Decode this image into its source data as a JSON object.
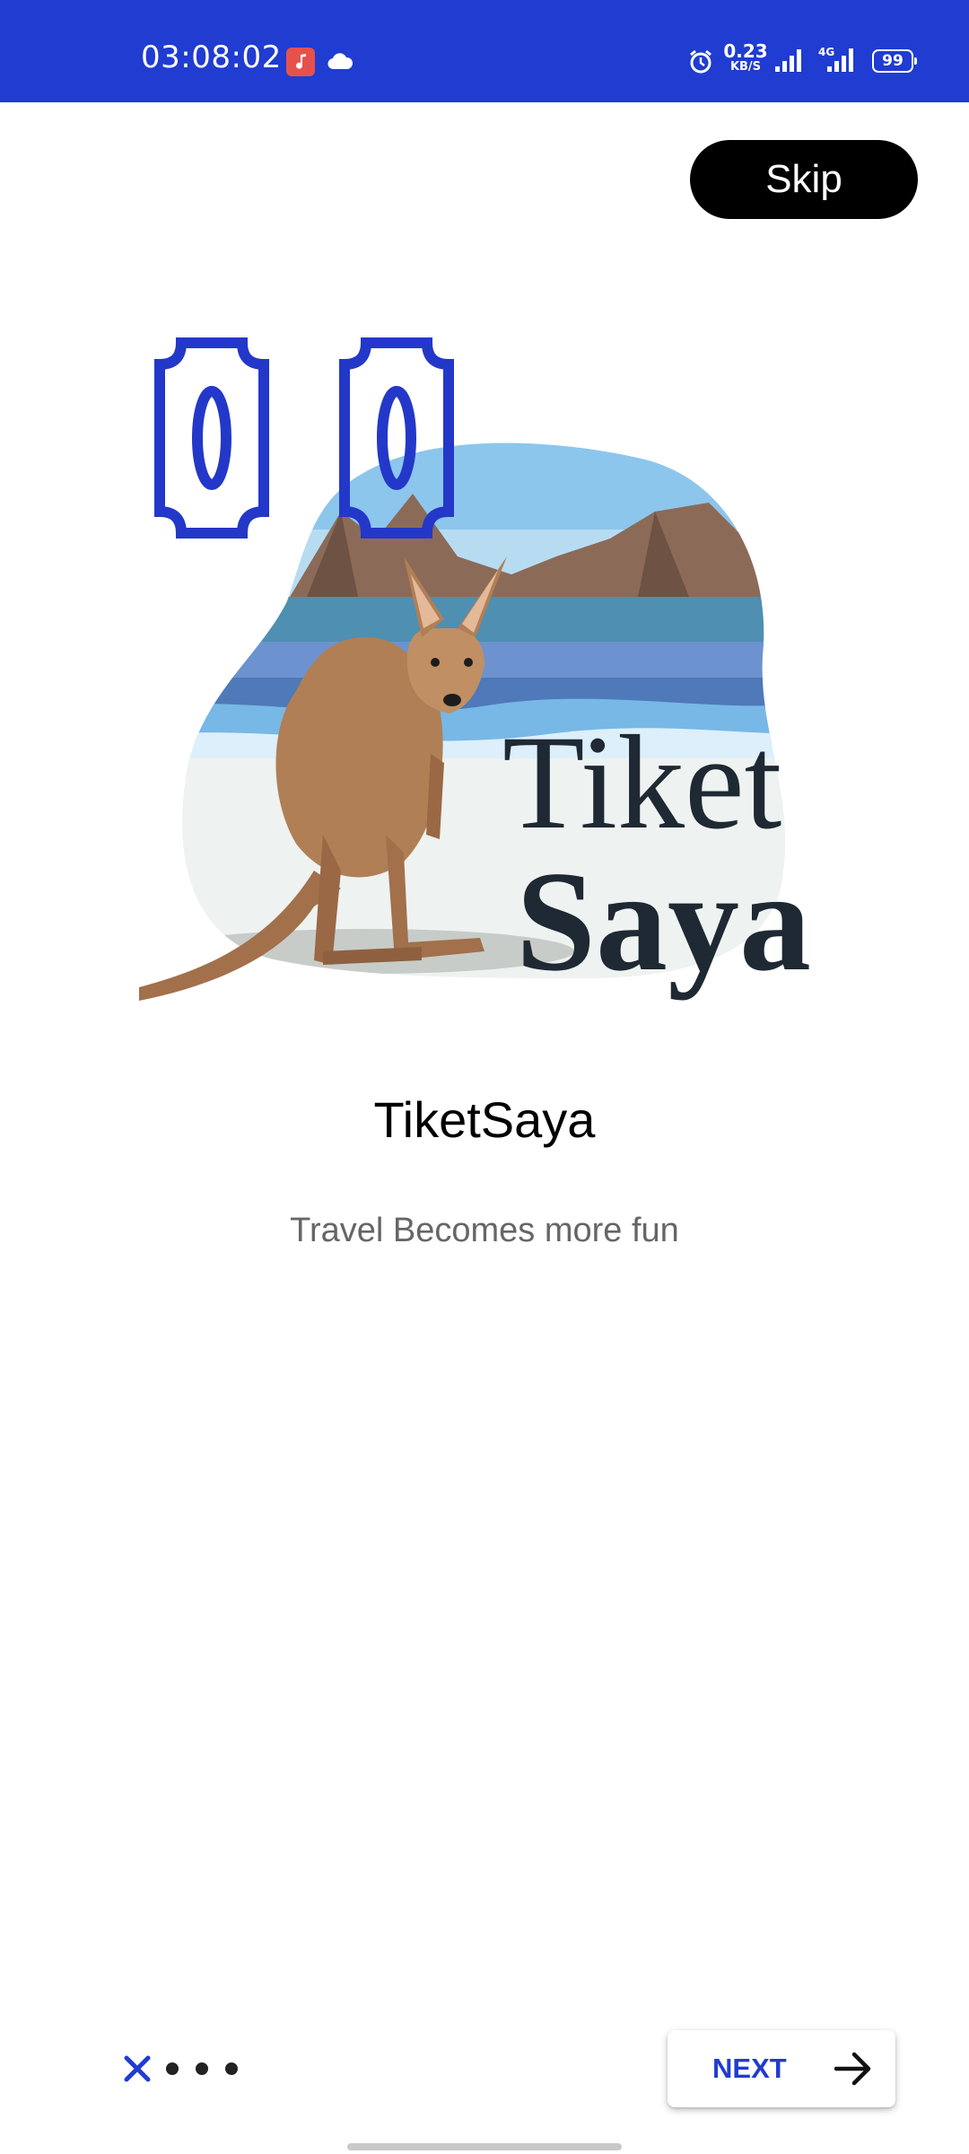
{
  "status_bar": {
    "time": "03:08:02",
    "speed_value": "0.23",
    "speed_unit": "KB/S",
    "network_label": "4G",
    "battery": "99",
    "background_color": "#203CD1"
  },
  "skip_button": {
    "label": "Skip"
  },
  "illustration": {
    "logo_line1": "Tiket",
    "logo_line2": "Saya"
  },
  "onboarding": {
    "title": "TiketSaya",
    "subtitle": "Travel Becomes more fun"
  },
  "pager": {
    "dot_count": 3
  },
  "next_button": {
    "label": "NEXT",
    "color": "#203CD1"
  }
}
